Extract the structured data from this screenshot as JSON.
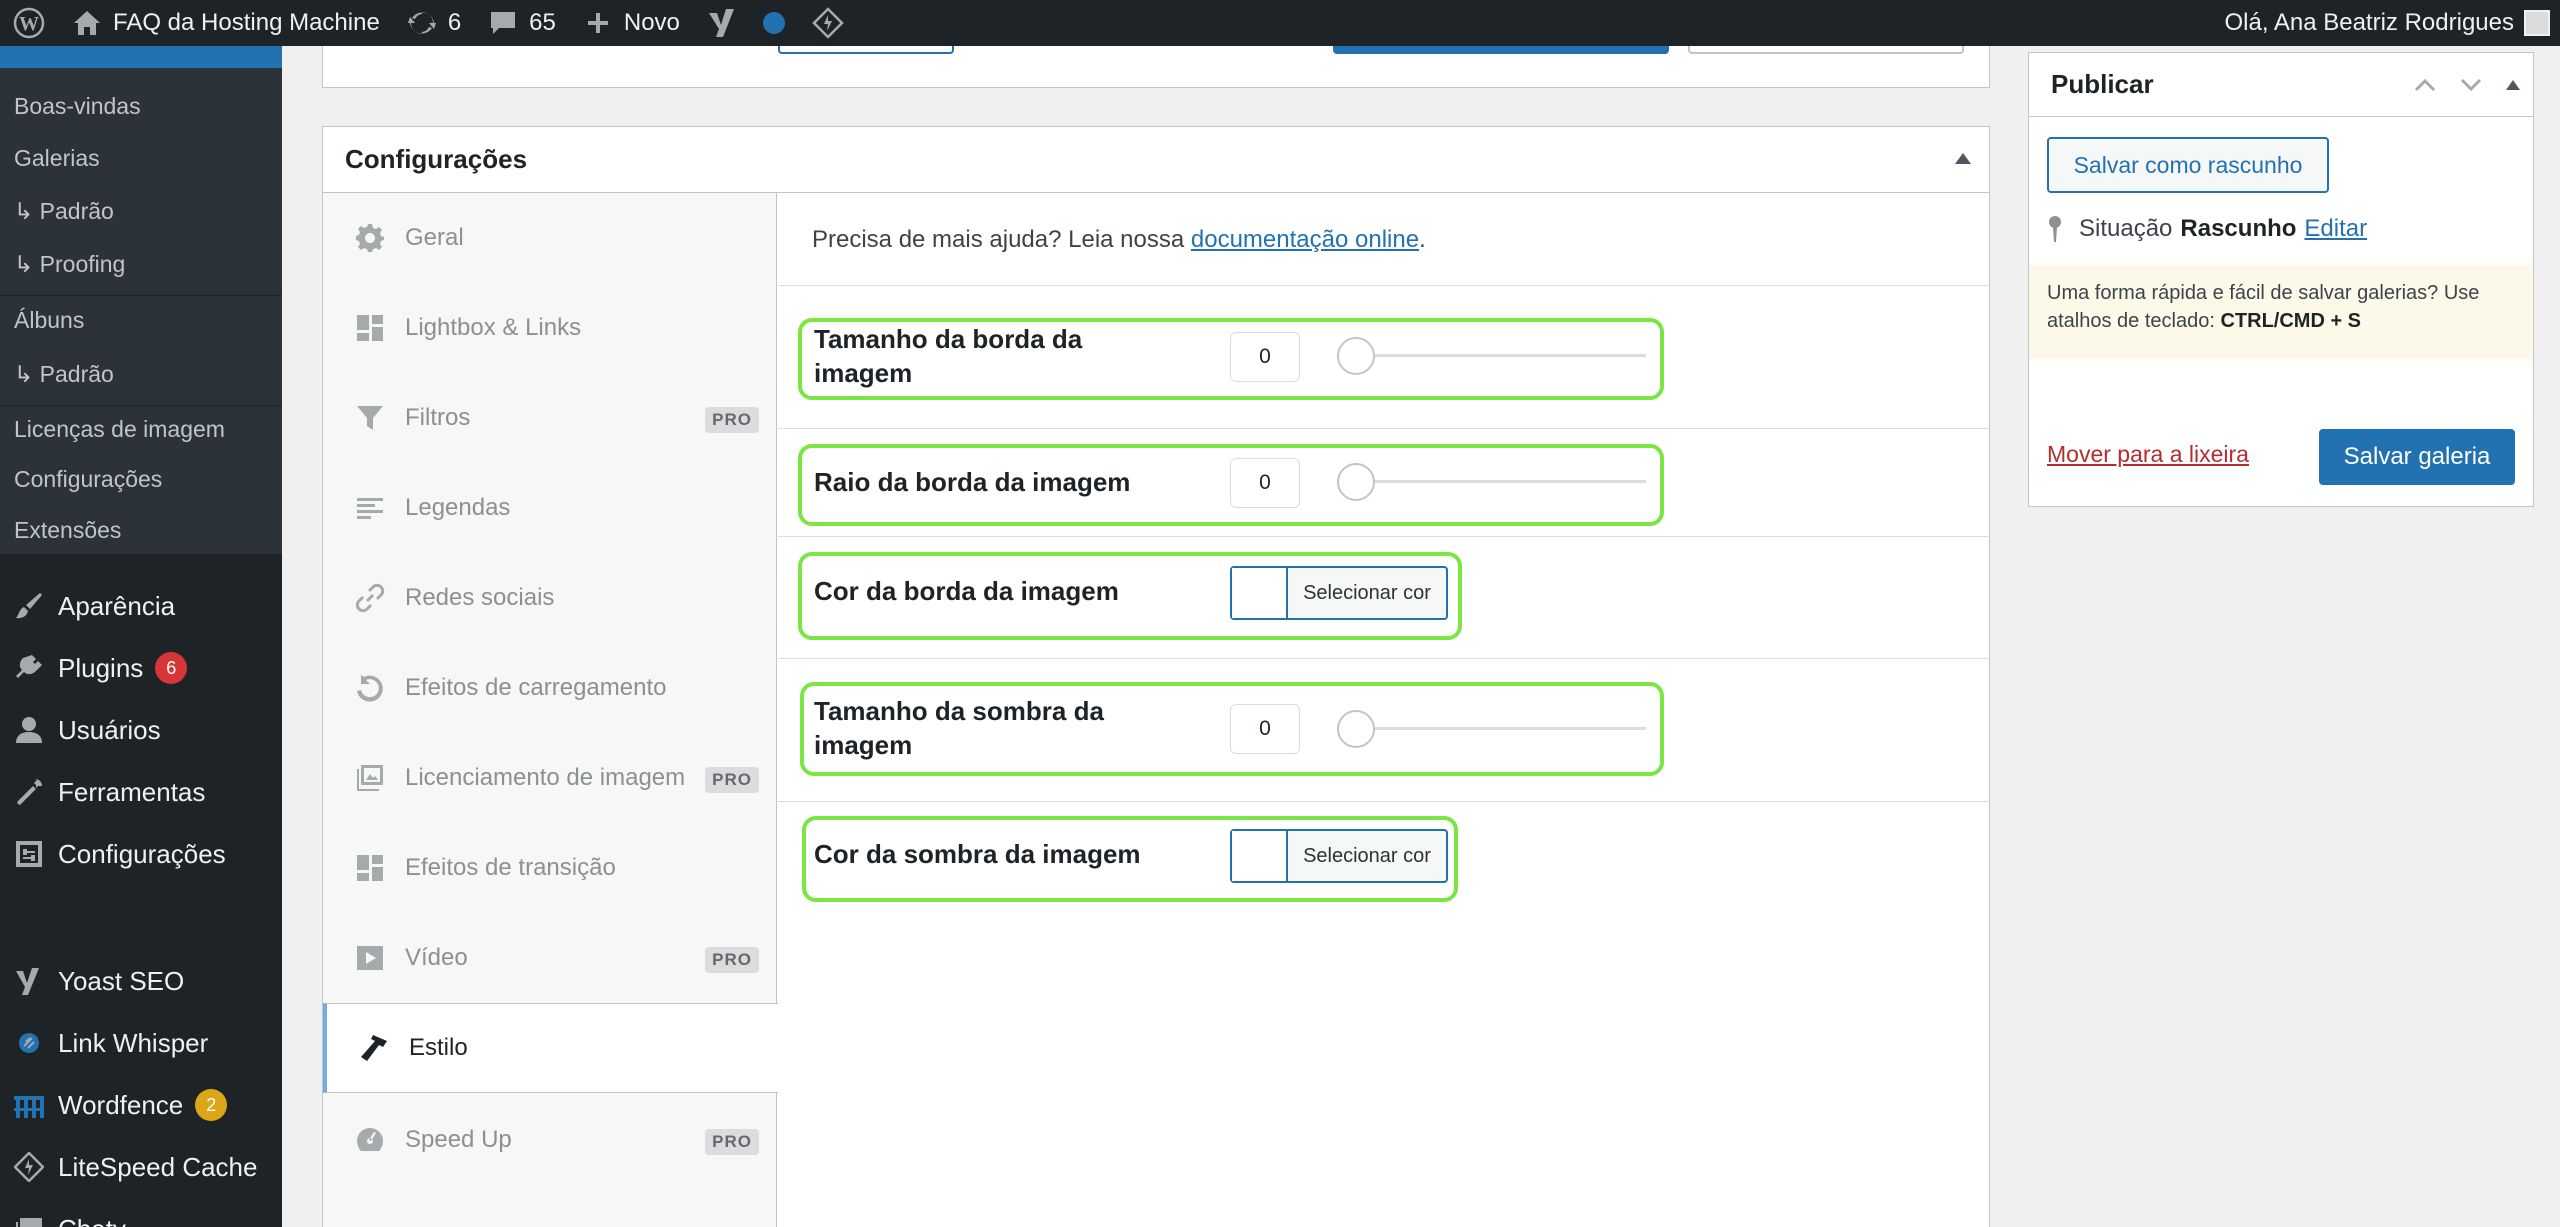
{
  "adminbar": {
    "site_name": "FAQ da Hosting Machine",
    "updates_count": "6",
    "comments_count": "65",
    "new_label": "Novo",
    "greeting": "Olá, Ana Beatriz Rodrigues"
  },
  "sidebar": {
    "submenu": [
      "Boas-vindas",
      "Galerias",
      "↳ Padrão",
      "↳ Proofing",
      "Álbuns",
      "↳ Padrão",
      "Licenças de imagem",
      "Configurações",
      "Extensões"
    ],
    "menu": [
      {
        "label": "Aparência",
        "icon": "paintbrush-icon"
      },
      {
        "label": "Plugins",
        "icon": "plugins-icon",
        "badge": "6",
        "badge_color": "#d63638"
      },
      {
        "label": "Usuários",
        "icon": "users-icon"
      },
      {
        "label": "Ferramentas",
        "icon": "tools-icon"
      },
      {
        "label": "Configurações",
        "icon": "settings-icon"
      },
      {
        "label": "Yoast SEO",
        "icon": "yoast-icon"
      },
      {
        "label": "Link Whisper",
        "icon": "link-whisper-icon"
      },
      {
        "label": "Wordfence",
        "icon": "wordfence-icon",
        "badge": "2",
        "badge_color": "#dba617"
      },
      {
        "label": "LiteSpeed Cache",
        "icon": "litespeed-icon"
      },
      {
        "label": "Chaty",
        "icon": "chaty-icon"
      }
    ]
  },
  "config": {
    "title": "Configurações",
    "tabs": [
      {
        "label": "Geral",
        "icon": "gear-icon",
        "pro": false
      },
      {
        "label": "Lightbox & Links",
        "icon": "grid-icon",
        "pro": false
      },
      {
        "label": "Filtros",
        "icon": "filter-icon",
        "pro": true
      },
      {
        "label": "Legendas",
        "icon": "text-lines-icon",
        "pro": false
      },
      {
        "label": "Redes sociais",
        "icon": "link-icon",
        "pro": false
      },
      {
        "label": "Efeitos de carregamento",
        "icon": "reload-icon",
        "pro": false
      },
      {
        "label": "Licenciamento de imagem",
        "icon": "images-icon",
        "pro": true
      },
      {
        "label": "Efeitos de transição",
        "icon": "grid-icon",
        "pro": false
      },
      {
        "label": "Vídeo",
        "icon": "video-icon",
        "pro": true
      },
      {
        "label": "Estilo",
        "icon": "hammer-icon",
        "pro": false,
        "active": true
      },
      {
        "label": "Speed Up",
        "icon": "dashboard-icon",
        "pro": true
      }
    ],
    "pro_badge": "PRO",
    "help_prefix": "Precisa de mais ajuda? Leia nossa ",
    "help_link": "documentação online",
    "help_suffix": ".",
    "fields": {
      "border_size": {
        "label": "Tamanho da borda da imagem",
        "value": "0"
      },
      "border_radius": {
        "label": "Raio da borda da imagem",
        "value": "0"
      },
      "border_color": {
        "label": "Cor da borda da imagem",
        "button": "Selecionar cor"
      },
      "shadow_size": {
        "label": "Tamanho da sombra da imagem",
        "value": "0"
      },
      "shadow_color": {
        "label": "Cor da sombra da imagem",
        "button": "Selecionar cor"
      }
    }
  },
  "publish": {
    "title": "Publicar",
    "save_draft": "Salvar como rascunho",
    "status_label": "Situação",
    "status_value": "Rascunho",
    "edit_link": "Editar",
    "tip_text": "Uma forma rápida e fácil de salvar galerias? Use atalhos de teclado: ",
    "tip_shortcut": "CTRL/CMD + S",
    "trash_link": "Mover para a lixeira",
    "save_button": "Salvar galeria"
  },
  "colors": {
    "admin_dark": "#1d2327",
    "accent_blue": "#2271b1",
    "highlight_green": "#7be542",
    "danger_red": "#b32d2e"
  }
}
